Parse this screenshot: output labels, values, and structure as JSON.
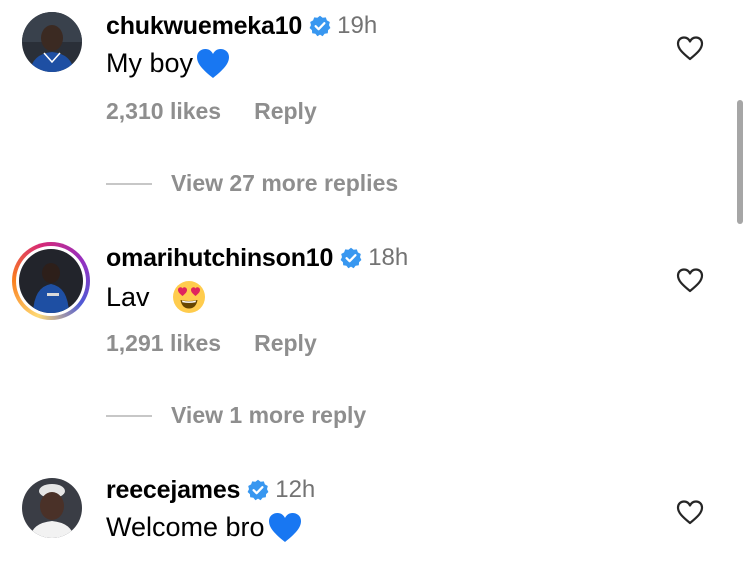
{
  "comments": [
    {
      "username": "chukwuemeka10",
      "verified": true,
      "time": "19h",
      "text": "My boy",
      "emoji": "blue-heart",
      "likes": "2,310 likes",
      "reply_label": "Reply",
      "view_replies": "View 27 more replies",
      "story_ring": false
    },
    {
      "username": "omarihutchinson10",
      "verified": true,
      "time": "18h",
      "text": "Lav",
      "emoji": "heart-eyes",
      "likes": "1,291 likes",
      "reply_label": "Reply",
      "view_replies": "View 1 more reply",
      "story_ring": true
    },
    {
      "username": "reecejames",
      "verified": true,
      "time": "12h",
      "text": "Welcome bro",
      "emoji": "blue-heart",
      "story_ring": false
    }
  ],
  "colors": {
    "verified_badge": "#3897f0",
    "secondary_text": "#8e8e8e",
    "timestamp": "#737373",
    "blue_heart": "#1877f2"
  }
}
